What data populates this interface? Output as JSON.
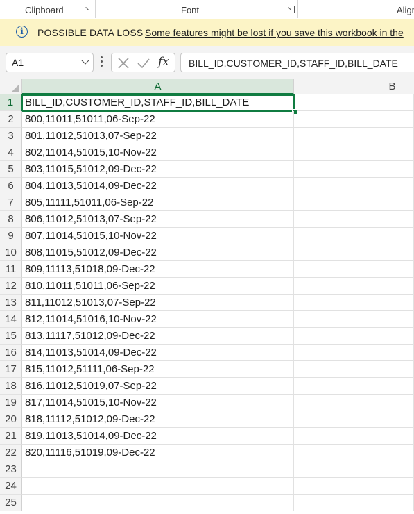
{
  "ribbon": {
    "groups": [
      "Clipboard",
      "Font",
      "Align"
    ]
  },
  "banner": {
    "title": "POSSIBLE DATA LOSS",
    "message": "Some features might be lost if you save this workbook in the"
  },
  "formula_bar": {
    "name_box": "A1",
    "formula": "BILL_ID,CUSTOMER_ID,STAFF_ID,BILL_DATE"
  },
  "columns": [
    "A",
    "B"
  ],
  "rows": [
    {
      "num": "1",
      "a": "BILL_ID,CUSTOMER_ID,STAFF_ID,BILL_DATE"
    },
    {
      "num": "2",
      "a": "800,11011,51011,06-Sep-22"
    },
    {
      "num": "3",
      "a": "801,11012,51013,07-Sep-22"
    },
    {
      "num": "4",
      "a": "802,11014,51015,10-Nov-22"
    },
    {
      "num": "5",
      "a": "803,11015,51012,09-Dec-22"
    },
    {
      "num": "6",
      "a": "804,11013,51014,09-Dec-22"
    },
    {
      "num": "7",
      "a": "805,11111,51011,06-Sep-22"
    },
    {
      "num": "8",
      "a": "806,11012,51013,07-Sep-22"
    },
    {
      "num": "9",
      "a": "807,11014,51015,10-Nov-22"
    },
    {
      "num": "10",
      "a": "808,11015,51012,09-Dec-22"
    },
    {
      "num": "11",
      "a": "809,11113,51018,09-Dec-22"
    },
    {
      "num": "12",
      "a": "810,11011,51011,06-Sep-22"
    },
    {
      "num": "13",
      "a": "811,11012,51013,07-Sep-22"
    },
    {
      "num": "14",
      "a": "812,11014,51016,10-Nov-22"
    },
    {
      "num": "15",
      "a": "813,11117,51012,09-Dec-22"
    },
    {
      "num": "16",
      "a": "814,11013,51014,09-Dec-22"
    },
    {
      "num": "17",
      "a": "815,11012,51111,06-Sep-22"
    },
    {
      "num": "18",
      "a": "816,11012,51019,07-Sep-22"
    },
    {
      "num": "19",
      "a": "817,11014,51015,10-Nov-22"
    },
    {
      "num": "20",
      "a": "818,11112,51012,09-Dec-22"
    },
    {
      "num": "21",
      "a": "819,11013,51014,09-Dec-22"
    },
    {
      "num": "22",
      "a": "820,11116,51019,09-Dec-22"
    },
    {
      "num": "23",
      "a": ""
    },
    {
      "num": "24",
      "a": ""
    },
    {
      "num": "25",
      "a": ""
    }
  ],
  "colors": {
    "accent": "#107c41",
    "banner_bg": "#fcf4c6",
    "info_icon": "#1f5ea8"
  },
  "icons": [
    "info-icon",
    "chevron-down-icon",
    "more-dots-icon",
    "cancel-icon",
    "enter-icon",
    "fx-icon",
    "dialog-launcher-icon"
  ]
}
